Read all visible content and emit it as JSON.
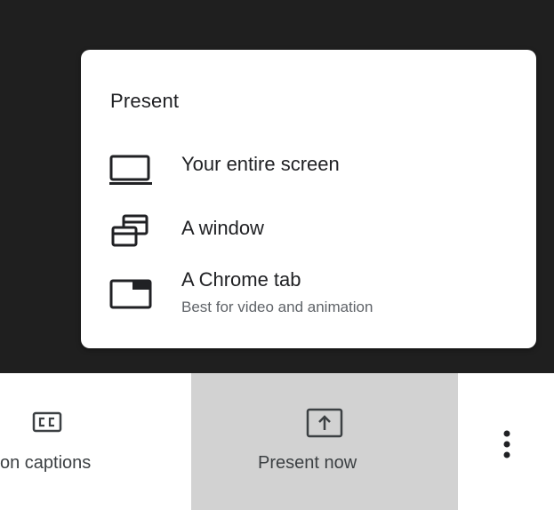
{
  "menu": {
    "title": "Present",
    "items": [
      {
        "label": "Your entire screen",
        "icon": "laptop-icon"
      },
      {
        "label": "A window",
        "icon": "window-stack-icon"
      },
      {
        "label": "A Chrome tab",
        "sublabel": "Best for video and animation",
        "icon": "browser-tab-icon"
      }
    ]
  },
  "toolbar": {
    "captions_label": "on captions",
    "captions_icon": "closed-captions-icon",
    "present_label": "Present now",
    "present_icon": "present-upload-icon",
    "more_icon": "more-vert-icon"
  },
  "colors": {
    "stage_background": "#1f1f1f",
    "menu_background": "#ffffff",
    "primary_text": "#202124",
    "secondary_text": "#5f6368",
    "active_button_background": "#d2d2d2"
  }
}
